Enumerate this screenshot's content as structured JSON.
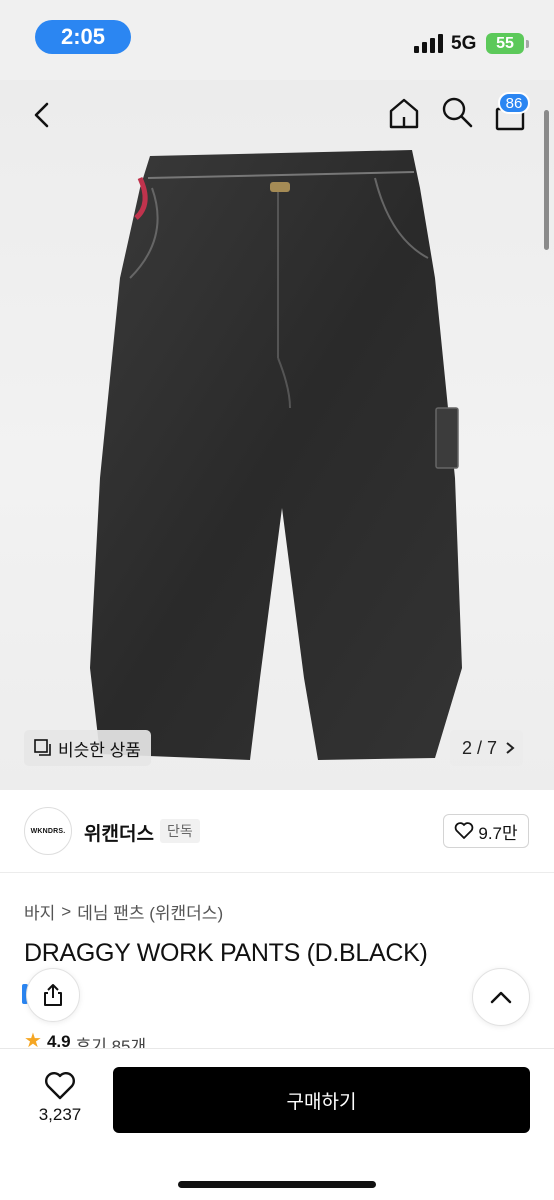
{
  "status": {
    "time": "2:05",
    "network": "5G",
    "battery": "55"
  },
  "nav": {
    "cart_count": "86"
  },
  "hero": {
    "similar_label": "비슷한 상품",
    "page_current": "2",
    "page_total": "7",
    "pager_text": "2 / 7"
  },
  "brand": {
    "logo_text": "WKNDRS.",
    "name": "위캔더스",
    "tag": "단독",
    "likes": "9.7만"
  },
  "breadcrumb": {
    "category": "바지",
    "separator": ">",
    "subcategory": "데님 팬츠 (위캔더스)"
  },
  "product": {
    "title": "DRAGGY WORK PANTS (D.BLACK)",
    "rating": "4.9",
    "review_label": "후기 85개"
  },
  "bottom": {
    "wish_count": "3,237",
    "buy_label": "구매하기"
  },
  "icons": [
    "chevron-left-icon",
    "home-icon",
    "search-icon",
    "shopping-bag-icon",
    "similar-items-icon",
    "chevron-right-icon",
    "heart-icon",
    "share-icon",
    "chevron-up-icon",
    "star-icon"
  ],
  "colors": {
    "accent": "#2b86f2",
    "buy_button": "#000000",
    "battery": "#5cc95a",
    "star": "#f5a623"
  }
}
